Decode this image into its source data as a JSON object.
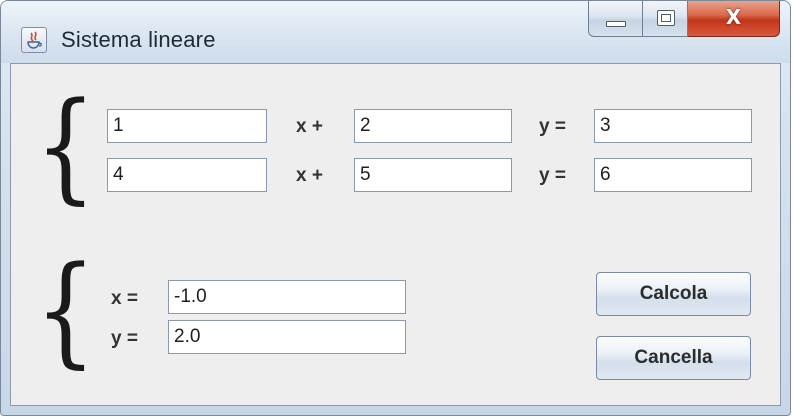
{
  "window": {
    "title": "Sistema lineare",
    "icon": "java-app-icon",
    "controls": {
      "minimize_icon": "minimize-icon",
      "maximize_icon": "maximize-icon",
      "close_icon": "close-icon",
      "close_glyph": "X"
    }
  },
  "equations": {
    "row1": {
      "coef_x": "1",
      "op_x": "x +",
      "coef_y": "2",
      "op_y": "y =",
      "const": "3"
    },
    "row2": {
      "coef_x": "4",
      "op_x": "x +",
      "coef_y": "5",
      "op_y": "y =",
      "const": "6"
    }
  },
  "solution": {
    "x_label": "x =",
    "x_value": "-1.0",
    "y_label": "y =",
    "y_value": "2.0"
  },
  "buttons": {
    "calcola": "Calcola",
    "cancella": "Cancella"
  },
  "colors": {
    "client_bg": "#eeeeee",
    "close_button": "#c2361a",
    "field_bg": "#ffffff"
  }
}
